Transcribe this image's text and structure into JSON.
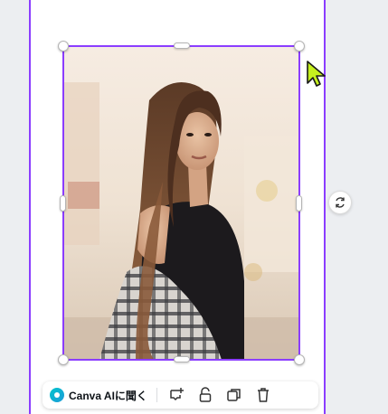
{
  "colors": {
    "selection": "#8b3dff",
    "canvas_background": "#eceef1",
    "page_background": "#ffffff",
    "cursor": "#c6f01e"
  },
  "toolbar": {
    "ai_label": "Canva AIに聞く",
    "ai_icon": "canva-ai-icon",
    "icons": [
      "comment-add-icon",
      "lock-icon",
      "duplicate-icon",
      "trash-icon"
    ]
  },
  "rotate_icon": "rotate-icon",
  "image": {
    "description_icon": "portrait-photo"
  }
}
